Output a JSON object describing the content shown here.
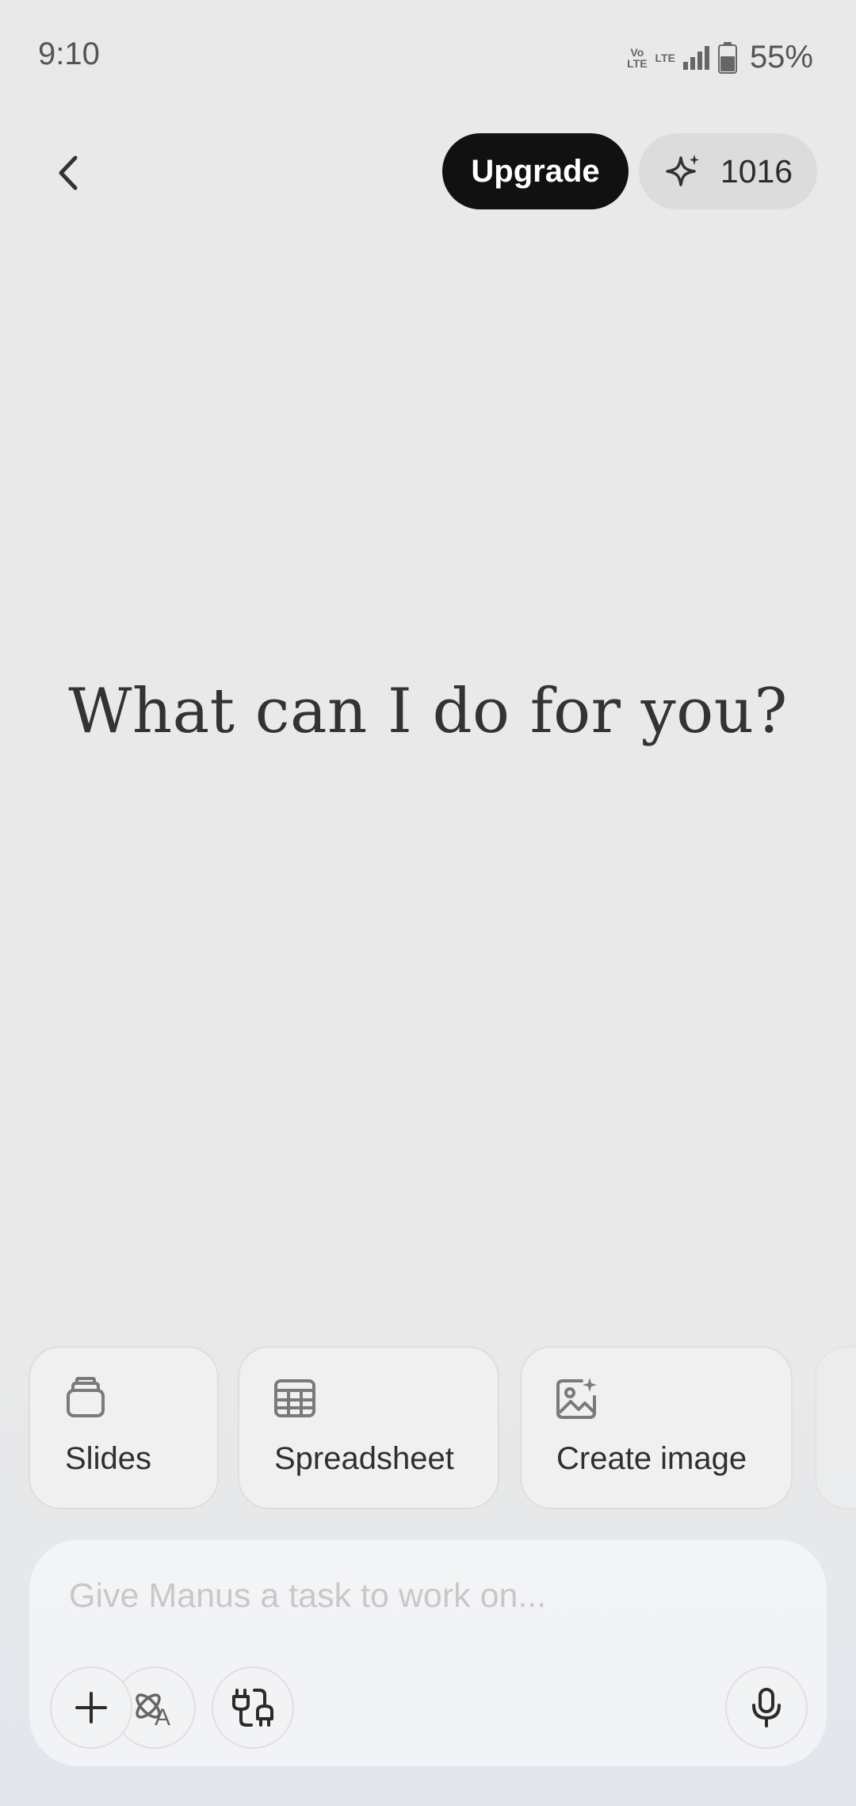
{
  "status_bar": {
    "time": "9:10",
    "net_left": "Vo\nLTE",
    "net_right": "LTE",
    "battery": "55%"
  },
  "header": {
    "upgrade_label": "Upgrade",
    "credits": "1016"
  },
  "main": {
    "headline": "What can I do for you?"
  },
  "quick_actions": [
    {
      "label": "Slides",
      "icon": "slides-icon"
    },
    {
      "label": "Spreadsheet",
      "icon": "table-icon"
    },
    {
      "label": "Create image",
      "icon": "image-sparkle-icon"
    }
  ],
  "composer": {
    "placeholder": "Give Manus a task to work on...",
    "value": ""
  },
  "colors": {
    "background": "#e9e9e9",
    "upgrade_bg": "#111111",
    "credits_bg": "#dcdcdc"
  }
}
